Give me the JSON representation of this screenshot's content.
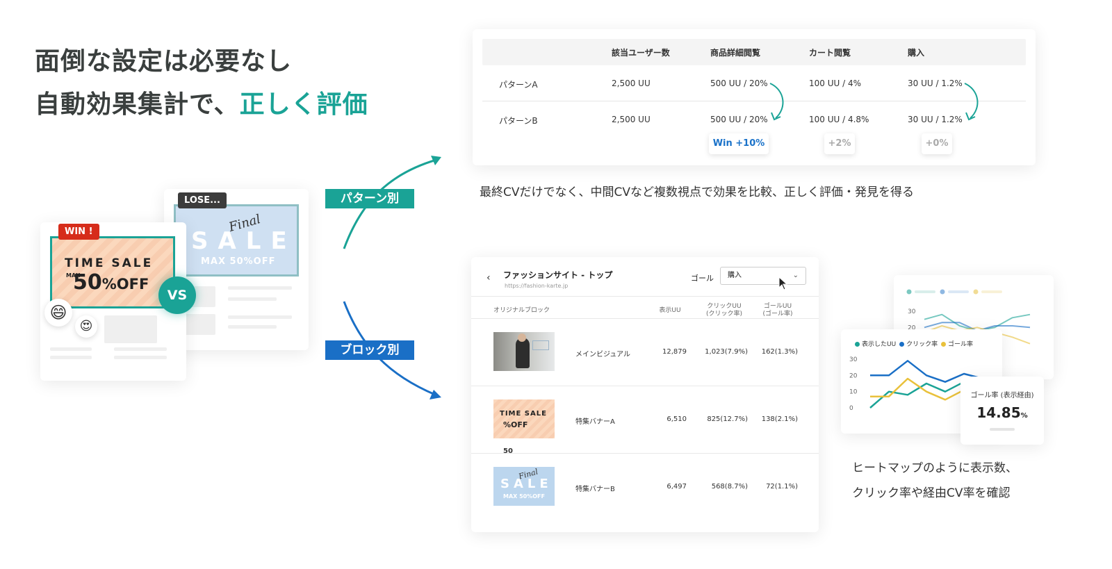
{
  "headline": {
    "line1": "面倒な設定は必要なし",
    "line2_prefix": "自動効果集計で、",
    "line2_accent": "正しく評価"
  },
  "comparison": {
    "headers": [
      "該当ユーザー数",
      "商品詳細閲覧",
      "カート閲覧",
      "購入"
    ],
    "rows": [
      {
        "label": "パターンA",
        "values": [
          "2,500 UU",
          "500 UU / 20%",
          "100 UU / 4%",
          "30 UU / 1.2%"
        ]
      },
      {
        "label": "パターンB",
        "values": [
          "2,500 UU",
          "500 UU / 20%",
          "100 UU / 4.8%",
          "30 UU / 1.2%"
        ]
      }
    ],
    "results": [
      "Win +10%",
      "+2%",
      "+0%"
    ],
    "caption": "最終CVだけでなく、中間CVなど複数視点で効果を比較、正しく評価・発見を得る"
  },
  "labels": {
    "pattern": "パターン別",
    "block": "ブロック別"
  },
  "ab_visual": {
    "lose_tag": "LOSE...",
    "win_tag": "WIN !",
    "vs": "VS",
    "back_banner": {
      "script": "Final",
      "title": "SALE",
      "sub": "MAX 50%OFF"
    },
    "front_banner": {
      "title": "TIME SALE",
      "max": "MAX",
      "big": "50",
      "suffix": "%OFF"
    },
    "emoji1": "😄",
    "emoji2": "😍"
  },
  "block_table": {
    "back_icon": "‹",
    "title": "ファッションサイト - トップ",
    "url": "https://fashion-karte.jp",
    "goal_label": "ゴール",
    "goal_value": "購入",
    "chevron": "⌄",
    "col_block": "オリジナルブロック",
    "col_views": "表示UU",
    "col_click_1": "クリックUU",
    "col_click_2": "(クリック率)",
    "col_goal_1": "ゴールUU",
    "col_goal_2": "(ゴール率)",
    "rows": [
      {
        "name": "メインビジュアル",
        "views": "12,879",
        "clicks": "1,023(7.9%)",
        "goals": "162(1.3%)"
      },
      {
        "name": "特集バナーA",
        "views": "6,510",
        "clicks": "825(12.7%)",
        "goals": "138(2.1%)"
      },
      {
        "name": "特集バナーB",
        "views": "6,497",
        "clicks": "568(8.7%)",
        "goals": "72(1.1%)"
      }
    ],
    "thumb_ts": {
      "title": "TIME SALE",
      "big": "50",
      "suffix": "%OFF"
    },
    "thumb_sale": {
      "script": "Final",
      "title": "SALE",
      "sub": "MAX 50%OFF"
    }
  },
  "chart_data": [
    {
      "type": "line",
      "x": [
        1,
        2,
        3,
        4,
        5,
        6,
        7
      ],
      "ylim": [
        0,
        30
      ],
      "yticks": [
        "30",
        "20"
      ],
      "series": [
        {
          "color": "#1aa396",
          "values": [
            25,
            28,
            21,
            18,
            20,
            26,
            28
          ]
        },
        {
          "color": "#1a6fc6",
          "values": [
            20,
            23,
            23,
            18,
            21,
            21,
            20
          ]
        },
        {
          "color": "#e9c13b",
          "values": [
            17,
            21,
            18,
            20,
            17,
            14,
            10
          ]
        }
      ]
    },
    {
      "type": "line",
      "x": [
        1,
        2,
        3,
        4,
        5,
        6,
        7
      ],
      "ylim": [
        0,
        30
      ],
      "yticks": [
        "30",
        "20",
        "10",
        "0"
      ],
      "legend": [
        "表示したUU",
        "クリック率",
        "ゴール率"
      ],
      "series": [
        {
          "name": "表示したUU",
          "color": "#1aa396",
          "values": [
            0,
            10,
            8,
            15,
            10,
            16,
            12
          ]
        },
        {
          "name": "クリック率",
          "color": "#1a6fc6",
          "values": [
            20,
            20,
            29,
            20,
            16,
            21,
            18
          ]
        },
        {
          "name": "ゴール率",
          "color": "#e9c13b",
          "values": [
            7,
            7,
            18,
            10,
            5,
            11,
            8
          ]
        }
      ]
    }
  ],
  "stat": {
    "label": "ゴール率 (表示経由)",
    "value": "14.85",
    "unit": "%"
  },
  "caption2": {
    "line1": "ヒートマップのように表示数、",
    "line2": "クリック率や経由CV率を確認"
  },
  "colors": {
    "teal": "#1aa396",
    "blue": "#1a6fc6",
    "yellow": "#e9c13b"
  }
}
